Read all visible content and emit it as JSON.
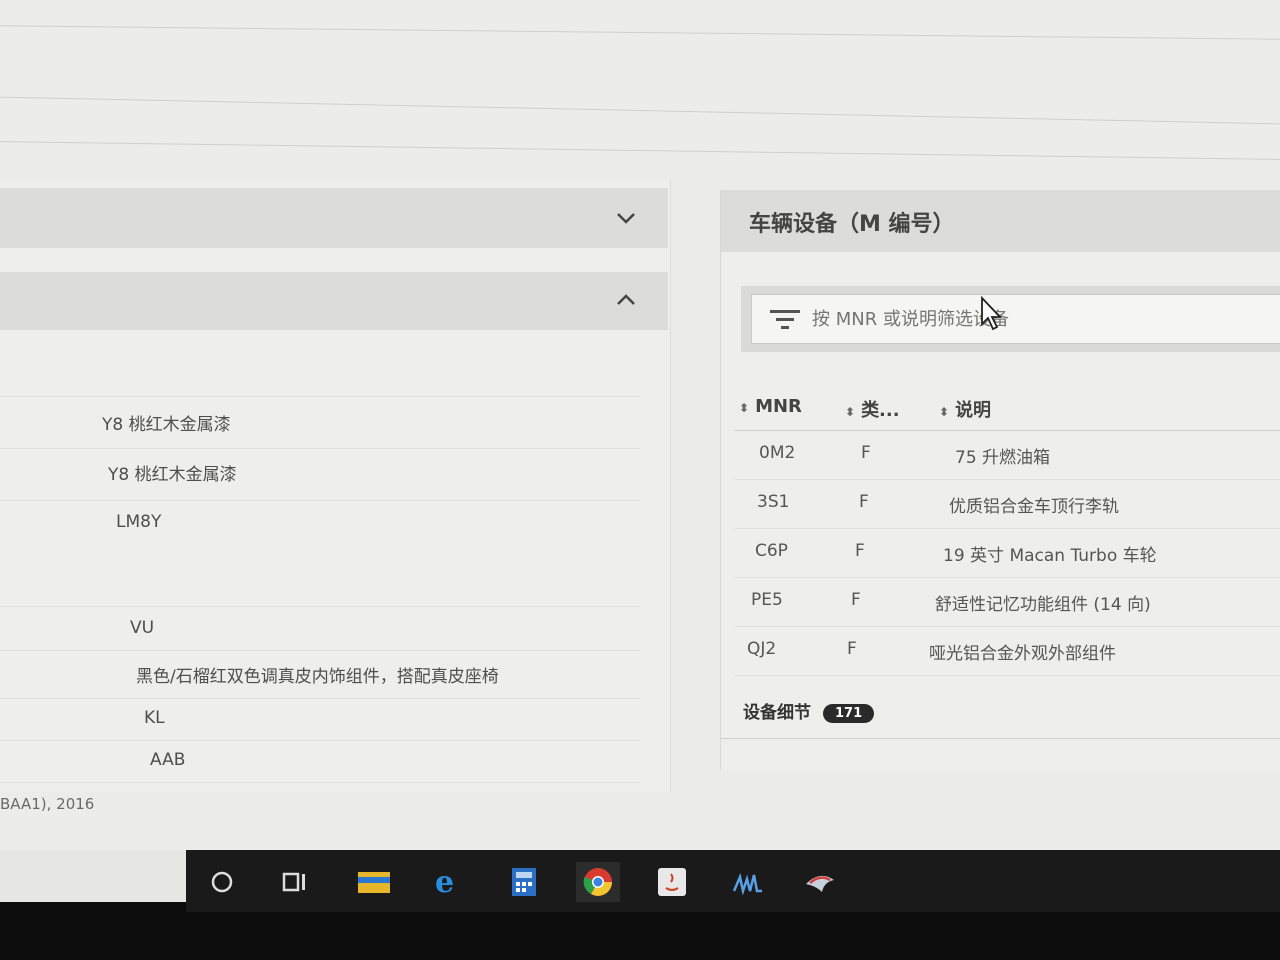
{
  "left": {
    "rows": [
      {
        "text": "Y8 桃红木金属漆"
      },
      {
        "text": "Y8 桃红木金属漆"
      },
      {
        "text": "LM8Y"
      },
      {
        "text": "VU"
      },
      {
        "text": "黑色/石榴红双色调真皮内饰组件，搭配真皮座椅"
      },
      {
        "text": "KL"
      },
      {
        "text": "AAB"
      }
    ],
    "footer": "BAA1), 2016"
  },
  "right": {
    "title": "车辆设备（M 编号）",
    "search_placeholder": "按 MNR 或说明筛选设备",
    "columns": {
      "mnr": "MNR",
      "type": "类...",
      "desc": "说明"
    },
    "rows": [
      {
        "mnr": "0M2",
        "type": "F",
        "desc": "75 升燃油箱"
      },
      {
        "mnr": "3S1",
        "type": "F",
        "desc": "优质铝合金车顶行李轨"
      },
      {
        "mnr": "C6P",
        "type": "F",
        "desc": "19 英寸 Macan Turbo 车轮"
      },
      {
        "mnr": "PE5",
        "type": "F",
        "desc": "舒适性记忆功能组件 (14 向)"
      },
      {
        "mnr": "QJ2",
        "type": "F",
        "desc": "哑光铝合金外观外部组件"
      }
    ],
    "details_label": "设备细节",
    "details_count": "171"
  },
  "taskbar": {
    "icons": [
      "search-circle-icon",
      "task-view-icon",
      "file-explorer-icon",
      "edge-browser-icon",
      "calculator-icon",
      "chrome-icon",
      "java-icon",
      "app-icon",
      "app2-icon"
    ]
  }
}
